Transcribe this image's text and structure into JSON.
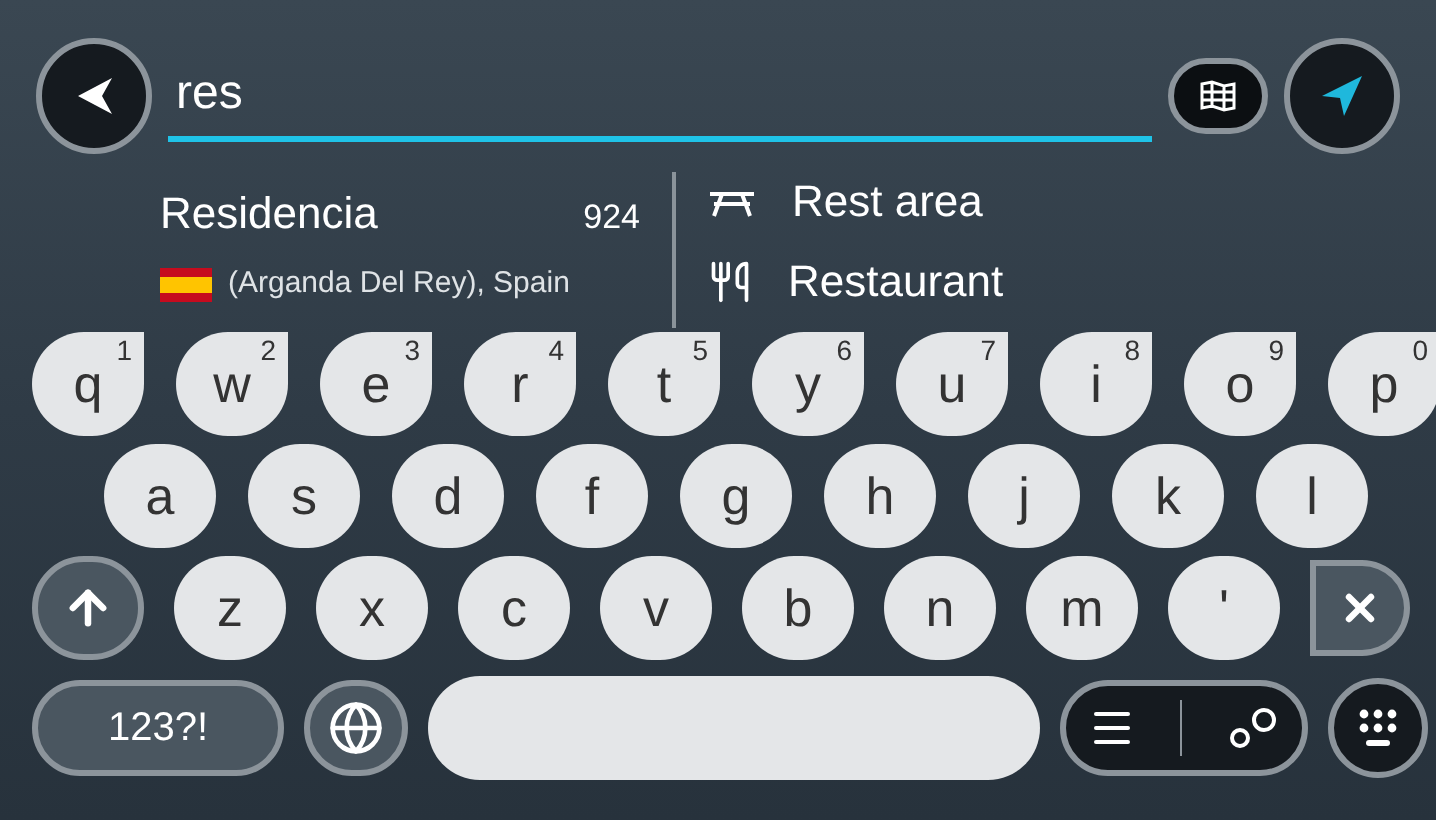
{
  "search": {
    "value": "res"
  },
  "results": [
    {
      "name": "Residencia",
      "distance": "924",
      "address": "(Arganda Del Rey), Spain"
    }
  ],
  "categories": [
    {
      "label": "Rest area",
      "kind": "rest"
    },
    {
      "label": "Restaurant",
      "kind": "food"
    }
  ],
  "keyboard": {
    "rows": [
      [
        {
          "key": "q",
          "alt": "1"
        },
        {
          "key": "w",
          "alt": "2"
        },
        {
          "key": "e",
          "alt": "3"
        },
        {
          "key": "r",
          "alt": "4"
        },
        {
          "key": "t",
          "alt": "5"
        },
        {
          "key": "y",
          "alt": "6"
        },
        {
          "key": "u",
          "alt": "7"
        },
        {
          "key": "i",
          "alt": "8"
        },
        {
          "key": "o",
          "alt": "9"
        },
        {
          "key": "p",
          "alt": "0"
        }
      ],
      [
        {
          "key": "a"
        },
        {
          "key": "s"
        },
        {
          "key": "d"
        },
        {
          "key": "f"
        },
        {
          "key": "g"
        },
        {
          "key": "h"
        },
        {
          "key": "j"
        },
        {
          "key": "k"
        },
        {
          "key": "l"
        }
      ],
      [
        {
          "key": "z"
        },
        {
          "key": "x"
        },
        {
          "key": "c"
        },
        {
          "key": "v"
        },
        {
          "key": "b"
        },
        {
          "key": "n"
        },
        {
          "key": "m"
        },
        {
          "key": "'"
        }
      ]
    ],
    "mode_key": "123?!"
  }
}
